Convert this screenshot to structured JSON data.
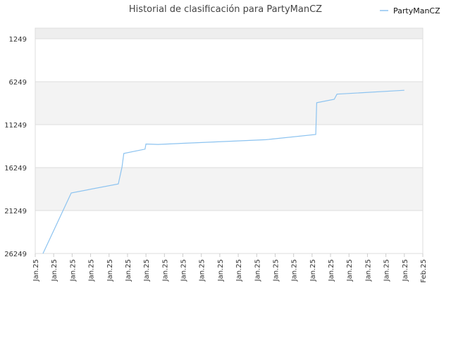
{
  "chart_data": {
    "type": "line",
    "title": "Historial de clasificación para PartyManCZ",
    "xlabel": "",
    "ylabel": "",
    "y_inverted": true,
    "ylim": [
      26249,
      0
    ],
    "y_ticks": [
      "1249",
      "6249",
      "11249",
      "16249",
      "21249",
      "26249"
    ],
    "y_tick_values": [
      1249,
      6249,
      11249,
      16249,
      21249,
      26249
    ],
    "x_ticks": [
      "Jan.25",
      "Jan.25",
      "Jan.25",
      "Jan.25",
      "Jan.25",
      "Jan.25",
      "Jan.25",
      "Jan.25",
      "Jan.25",
      "Jan.25",
      "Jan.25",
      "Jan.25",
      "Jan.25",
      "Jan.25",
      "Jan.25",
      "Jan.25",
      "Jan.25",
      "Jan.25",
      "Jan.25",
      "Jan.25",
      "Jan.25",
      "Feb.25"
    ],
    "x_range": [
      0,
      21
    ],
    "grid": true,
    "legend_position": "top-right",
    "series": [
      {
        "name": "PartyManCZ",
        "color": "#8cc3f0",
        "x": [
          0.42,
          1.95,
          4.5,
          4.7,
          4.8,
          5.95,
          6.0,
          6.65,
          8.8,
          12.5,
          15.2,
          15.25,
          16.2,
          16.35,
          20.0
        ],
        "y": [
          26249,
          19200,
          18150,
          16200,
          14600,
          14100,
          13500,
          13550,
          13350,
          13000,
          12400,
          8700,
          8300,
          7700,
          7250
        ]
      }
    ]
  }
}
